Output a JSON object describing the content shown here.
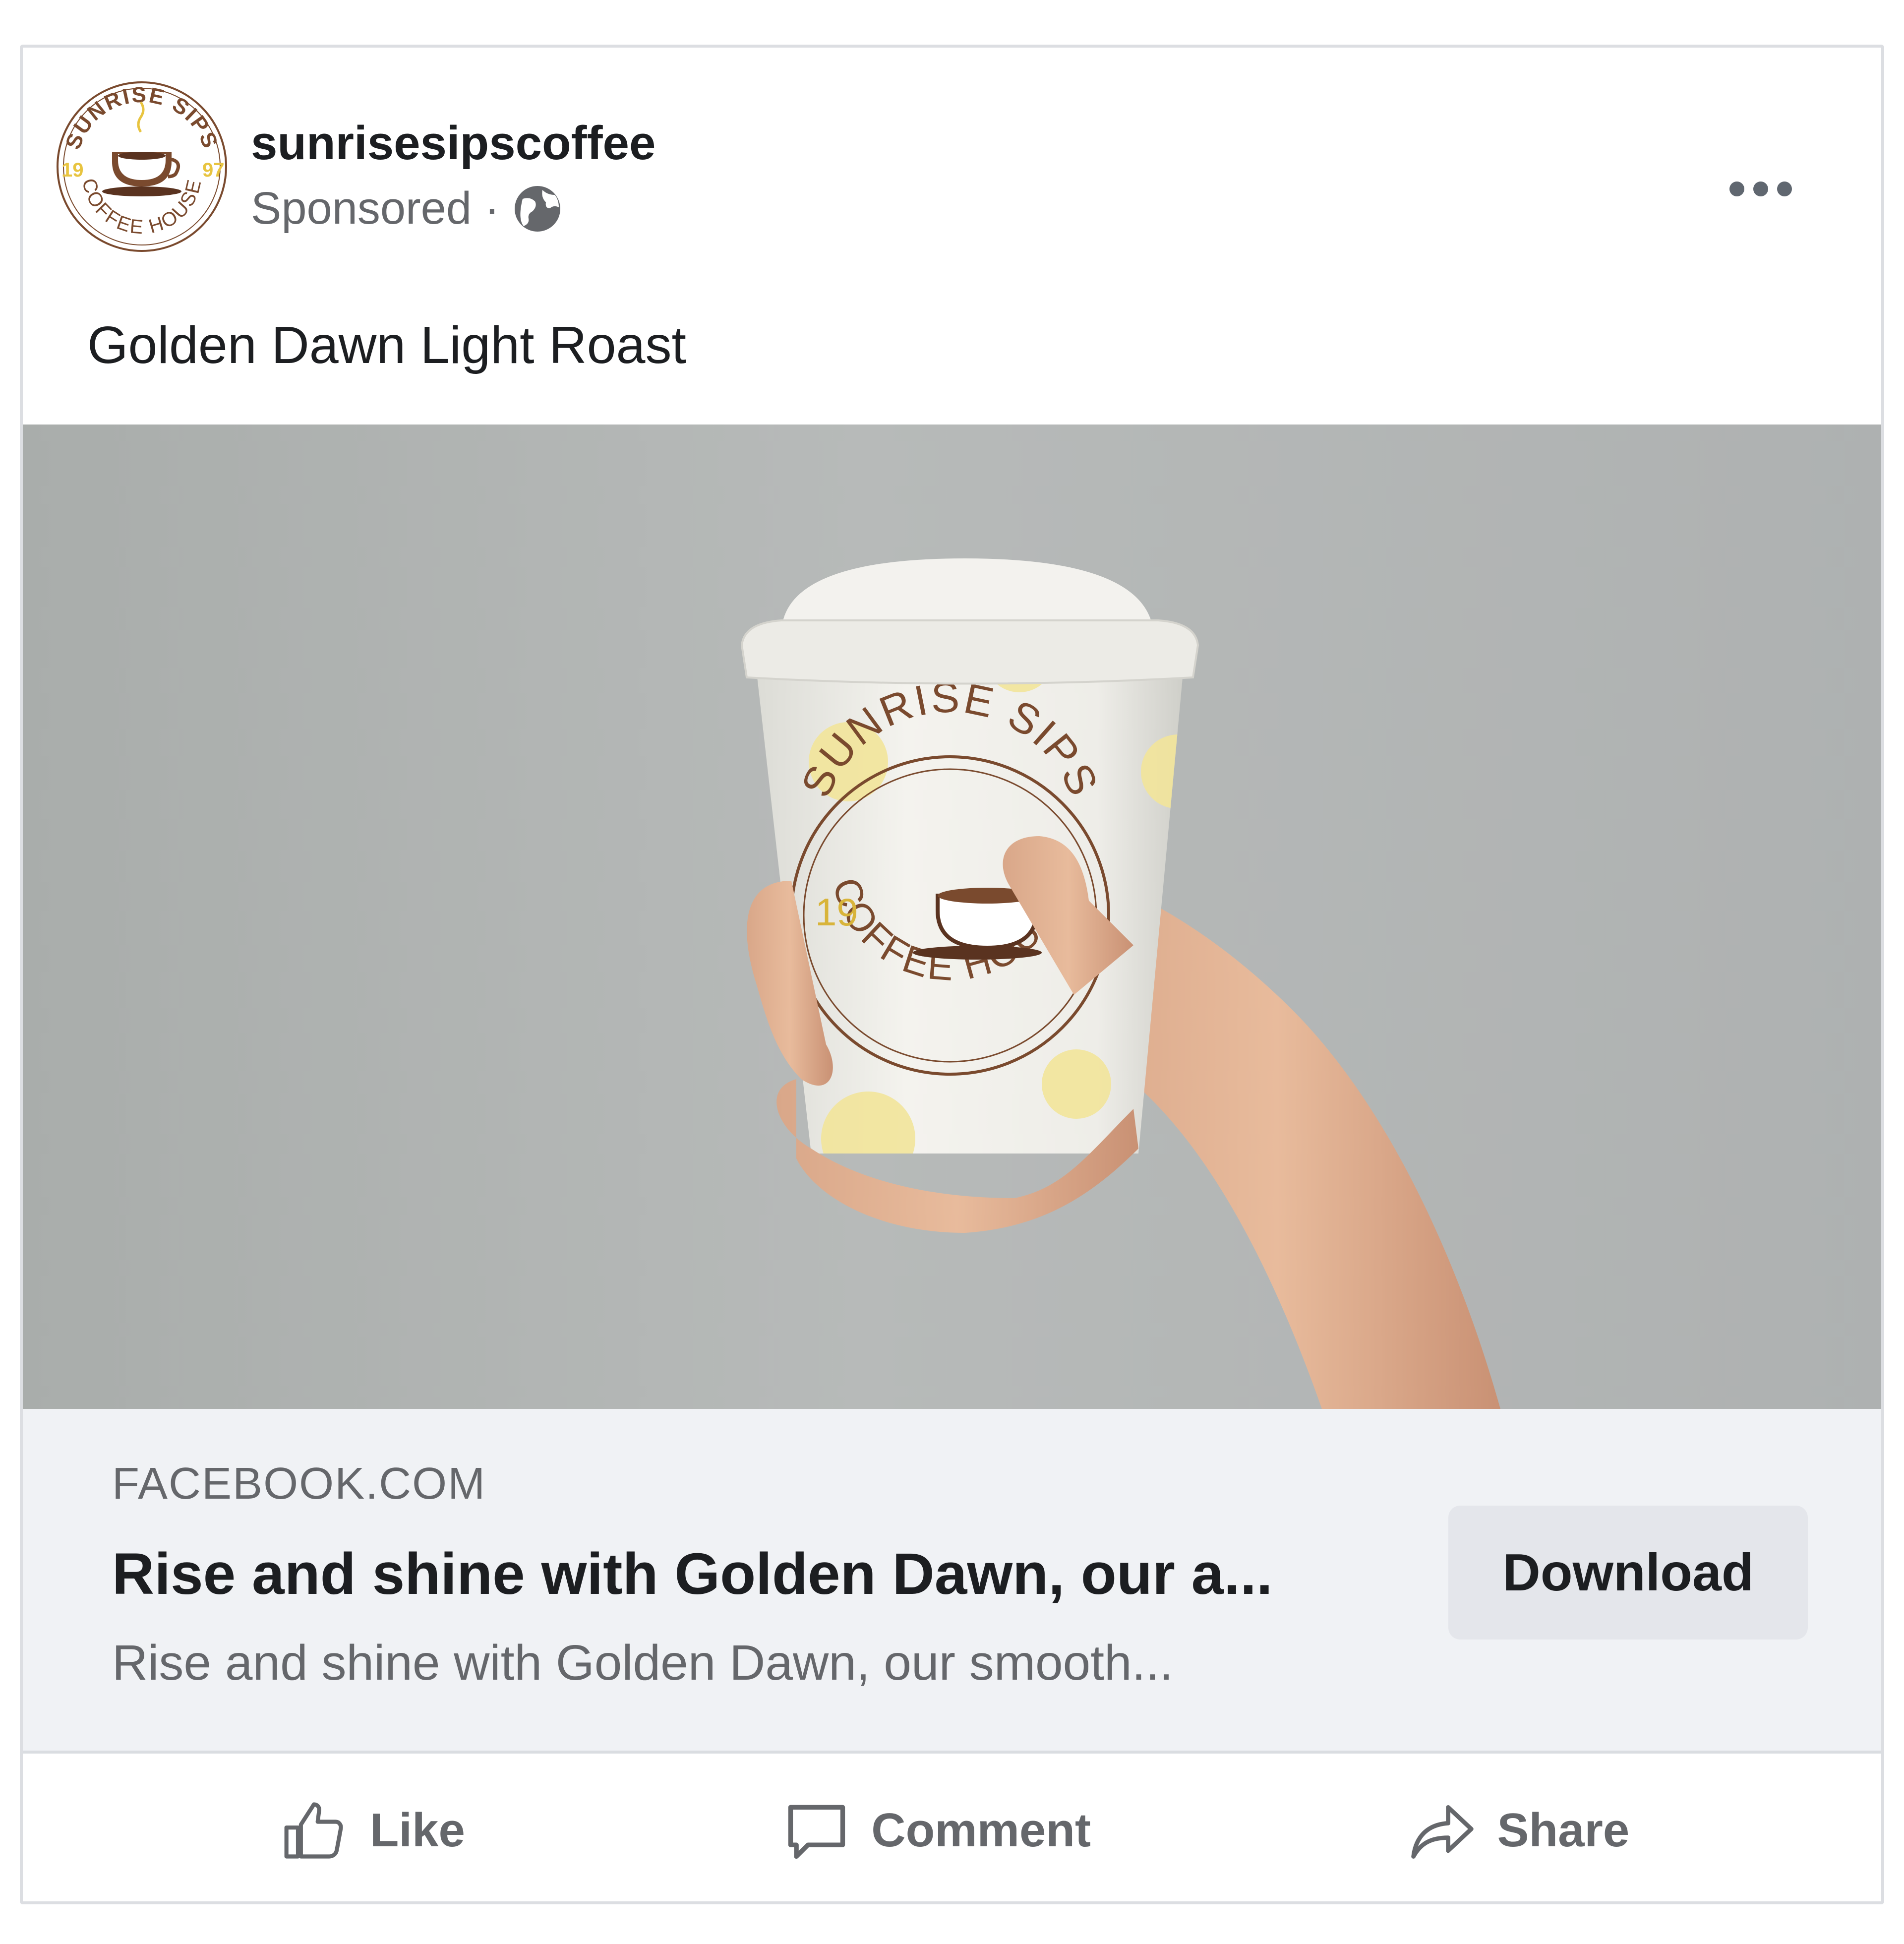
{
  "post": {
    "page_name": "sunrisesipscoffee",
    "sponsored_label": "Sponsored",
    "separator": "·",
    "text": "Golden Dawn Light Roast"
  },
  "logo": {
    "arc_top": "SUNRISE SIPS",
    "arc_bottom": "COFFEE HOUSE",
    "year_left": "19",
    "year_right": "97"
  },
  "cup_logo": {
    "arc_top": "SUNRISE SIPS",
    "arc_bottom": "COFFEE HOUSE",
    "year_left": "19"
  },
  "link_preview": {
    "domain": "FACEBOOK.COM",
    "headline": "Rise and shine with Golden Dawn, our a...",
    "description": "Rise and shine with Golden Dawn, our smooth...",
    "cta_label": "Download"
  },
  "actions": {
    "like": "Like",
    "comment": "Comment",
    "share": "Share"
  },
  "colors": {
    "brand_brown": "#7a4a2e",
    "brand_yellow": "#e8c440",
    "text_primary": "#1c1e21",
    "text_secondary": "#65676b",
    "preview_bg": "#f0f2f5"
  },
  "icons": [
    "globe-icon",
    "more-icon",
    "like-icon",
    "comment-icon",
    "share-icon",
    "coffee-cup-icon",
    "sun-icon"
  ]
}
